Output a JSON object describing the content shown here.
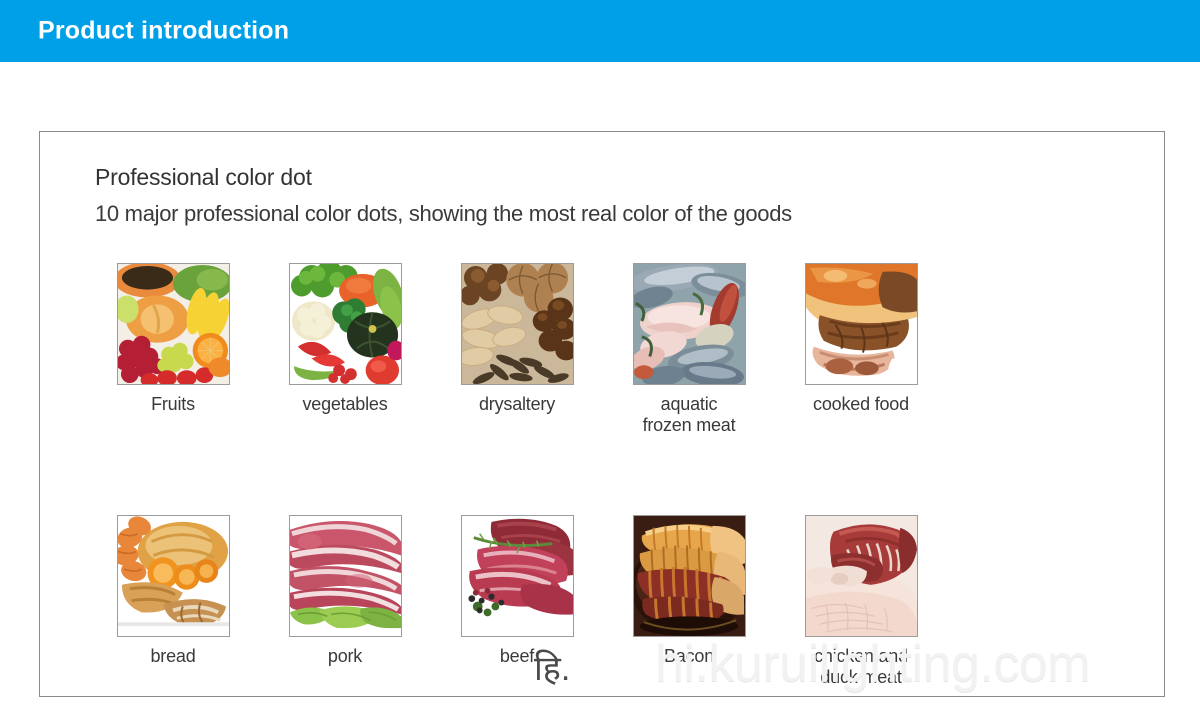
{
  "header": {
    "title": "Product introduction",
    "bar_color": "#00a0e9"
  },
  "panel": {
    "heading": "Professional color dot",
    "subheading": "10 major professional color dots, showing the most real color of the goods",
    "border_color": "#8a8a8a"
  },
  "grid": {
    "rows": [
      {
        "cells": [
          {
            "label": "Fruits",
            "image": "fruits-photo"
          },
          {
            "label": "vegetables",
            "image": "vegetables-photo"
          },
          {
            "label": "drysaltery",
            "image": "drysaltery-photo"
          },
          {
            "label": "aquatic\nfrozen meat",
            "image": "aquatic-frozen-meat-photo"
          },
          {
            "label": "cooked food",
            "image": "cooked-food-photo"
          }
        ]
      },
      {
        "cells": [
          {
            "label": "bread",
            "image": "bread-photo"
          },
          {
            "label": "pork",
            "image": "pork-photo"
          },
          {
            "label": "beef",
            "image": "beef-photo"
          },
          {
            "label": "Bacon",
            "image": "bacon-photo"
          },
          {
            "label": "chicken and\nduck meat",
            "image": "chicken-and-duck-meat-photo"
          }
        ]
      }
    ]
  },
  "watermark": {
    "prefix": "हि.",
    "text": "hi.kuruilighting.com",
    "color": "#f2f2f2"
  }
}
